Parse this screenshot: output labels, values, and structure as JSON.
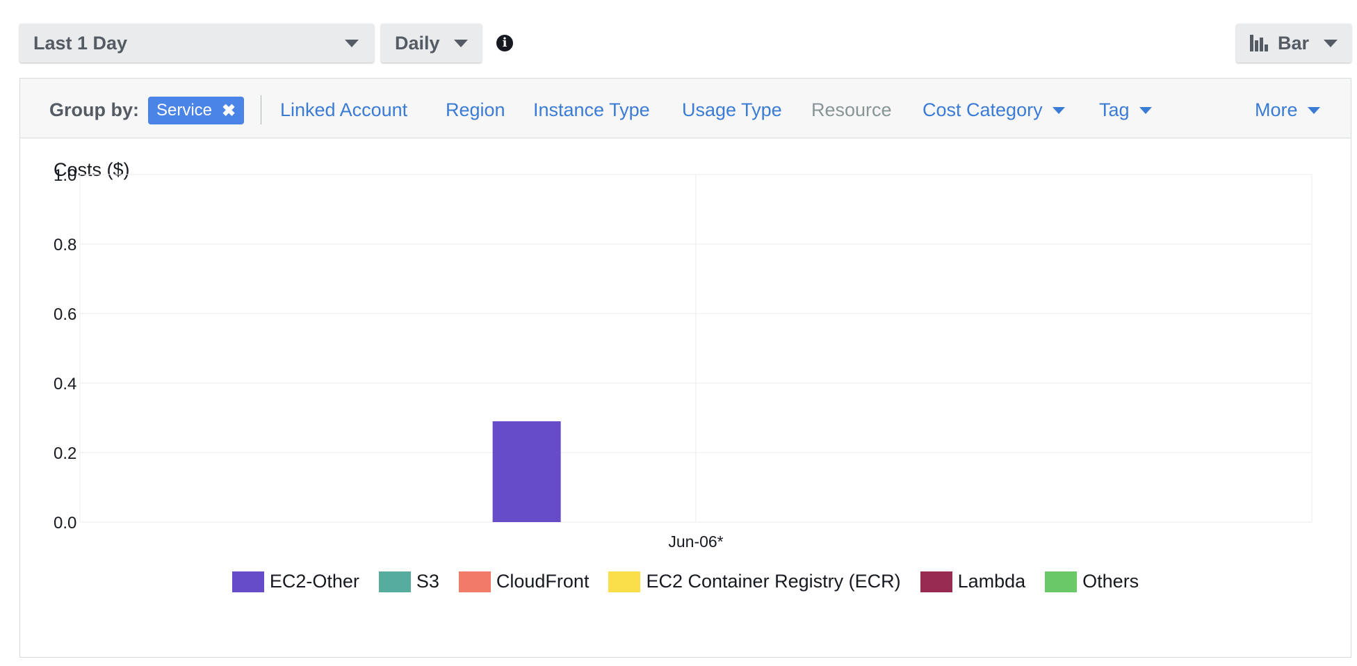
{
  "toolbar": {
    "range_label": "Last 1 Day",
    "granularity_label": "Daily",
    "chart_type_label": "Bar",
    "info_glyph": "i"
  },
  "groupby": {
    "label": "Group by:",
    "chip_label": "Service",
    "chip_remove_glyph": "✖",
    "options": [
      {
        "label": "Linked Account",
        "dropdown": false,
        "disabled": false
      },
      {
        "label": "Region",
        "dropdown": false,
        "disabled": false
      },
      {
        "label": "Instance Type",
        "dropdown": false,
        "disabled": false
      },
      {
        "label": "Usage Type",
        "dropdown": false,
        "disabled": false
      },
      {
        "label": "Resource",
        "dropdown": false,
        "disabled": true
      },
      {
        "label": "Cost Category",
        "dropdown": true,
        "disabled": false
      },
      {
        "label": "Tag",
        "dropdown": true,
        "disabled": false
      }
    ],
    "more_label": "More"
  },
  "chart_data": {
    "type": "bar",
    "ylabel": "Costs ($)",
    "ylim": [
      0,
      1.0
    ],
    "yticks": [
      "1.0",
      "0.8",
      "0.6",
      "0.4",
      "0.2",
      "0.0"
    ],
    "categories": [
      "Jun-06*"
    ],
    "grid": true,
    "legend_position": "bottom",
    "series": [
      {
        "name": "EC2-Other",
        "color": "#664cc6",
        "values": [
          0.29
        ]
      },
      {
        "name": "S3",
        "color": "#56ad9e",
        "values": [
          0.0
        ]
      },
      {
        "name": "CloudFront",
        "color": "#f27a68",
        "values": [
          0.0
        ]
      },
      {
        "name": "EC2 Container Registry (ECR)",
        "color": "#f9de4a",
        "values": [
          0.0
        ]
      },
      {
        "name": "Lambda",
        "color": "#972b52",
        "values": [
          0.0
        ]
      },
      {
        "name": "Others",
        "color": "#6ac966",
        "values": [
          0.0
        ]
      }
    ]
  }
}
